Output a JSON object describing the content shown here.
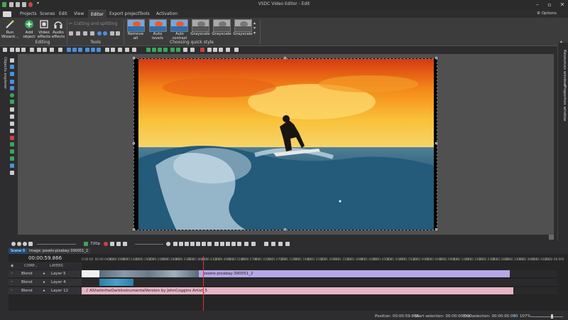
{
  "window": {
    "title": "VSDC Video Editor - Edit",
    "options_label": "Options"
  },
  "menu": {
    "tabs": [
      "Projects",
      "Scenes",
      "Edit",
      "View",
      "Editor",
      "Export project",
      "Tools",
      "Activation"
    ],
    "active": "Editor"
  },
  "ribbon": {
    "run_wizard": "Run Wizard...",
    "add_object": "Add object",
    "video_effects": "Video effects",
    "audio_effects": "Audio effects",
    "editing_label": "Editing",
    "cutting_label": "Cutting and splitting",
    "tools_label": "Tools",
    "quick_styles": [
      "Remove all",
      "Auto levels",
      "Auto contrast",
      "Grayscale",
      "Grayscale",
      "Grayscale"
    ],
    "quick_style_label": "Choosing quick style"
  },
  "left_panel": {
    "label": "Objects explorer"
  },
  "right_panel": {
    "resources": "Resources window",
    "properties": "Properties window"
  },
  "timeline": {
    "resolution": "720p",
    "scene_tab": "Scene 0",
    "image_tab": "Image: pexels-pixabay-390051_2",
    "current_time": "00:00:59.866",
    "comp_label": "COMP...",
    "layers_label": "LAYERS",
    "ruler": [
      "0:00:00",
      "00:00:04.800",
      "00:00:09.600",
      "00:00:14.400",
      "00:00:19.200",
      "00:00:24.000",
      "00:00:28.800",
      "00:00:33.600",
      "00:00:38.400",
      "00:00:43.200",
      "00:00:48.000",
      "00:00:52.800",
      "00:00:57.600",
      "00:01:02.400",
      "00:01:07.200",
      "00:01:12.000",
      "00:01:16.800",
      "00:01:21.600",
      "00:01:26.400",
      "00:01:31.200",
      "00:01:36.000",
      "00:01:40.800",
      "00:01:45.600",
      "00:01:50.400",
      "00:01:55.200",
      "00:02:00.000",
      "00:02:04.800",
      "00:02:09.600",
      "00:02:14.400",
      "00:02:19.200",
      "00:02:24.000",
      "00:02:28.800",
      "00:02:33.600",
      "00:02:38.400",
      "00:02:43.200",
      "00:02:48.000"
    ],
    "tracks": [
      {
        "blend": "Blend",
        "layer": "Layer 5",
        "clip": "pexels-pixabay-390051_2"
      },
      {
        "blend": "Blend",
        "layer": "Layer 4",
        "clip": ""
      },
      {
        "blend": "Blend",
        "layer": "Layer 12",
        "clip": "AShotintheDarkInstrumentalVersion by JohnCoggins Artist_5"
      }
    ]
  },
  "status": {
    "position": "Position:  00:00:59.866",
    "start_selection": "Start selection:  00:00:00.000",
    "end_selection": "End selection:  00:00:00.000",
    "zoom": "107%"
  },
  "colors": {
    "bg": "#2d2d30",
    "ribbon": "#3c3c3c",
    "video_clip": "#b7a6e6",
    "audio_clip": "#e6b4c4",
    "playhead": "#dd3333"
  }
}
